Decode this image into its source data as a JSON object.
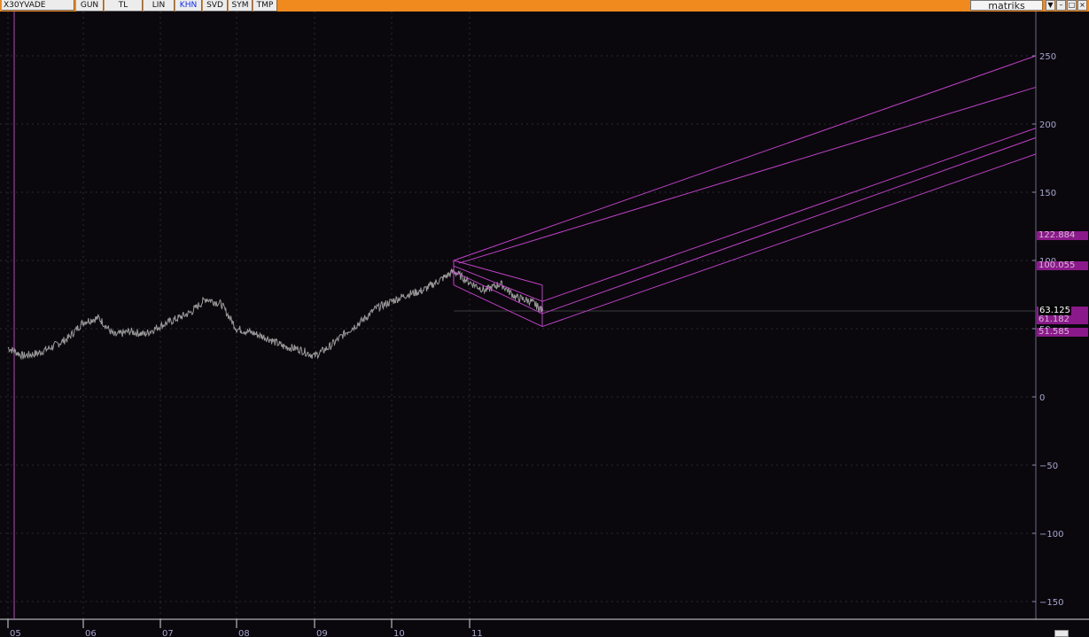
{
  "toolbar": {
    "symbol": "X30YVADE",
    "buttons": [
      "GUN",
      "TL",
      "LIN",
      "KHN",
      "SVD",
      "SYM",
      "TMP"
    ],
    "active_button": "KHN",
    "brand": "matriks",
    "window_controls": [
      "▼",
      "–",
      "□",
      "×"
    ]
  },
  "colors": {
    "toolbar_bg": "#f08a1f",
    "chart_bg": "#0a080c",
    "price_line": "#9a9a9a",
    "channel_lines": "#c040c8",
    "axis_text": "#a8a6d0",
    "tag_bg": "#8a1a8a"
  },
  "price_tags": {
    "upper": "122.884",
    "middle": "100.055",
    "last": "63.125",
    "hidden": "61.182",
    "lower": "51.585"
  },
  "chart_data": {
    "type": "line",
    "y_axis": {
      "ticks": [
        250,
        200,
        150,
        100,
        50,
        0,
        -50,
        -100,
        -150
      ],
      "tick_labels": [
        "250",
        "200",
        "150",
        "100",
        "50",
        "0",
        "−50",
        "−100",
        "−150"
      ],
      "range": [
        -158,
        280
      ],
      "position": "right",
      "grid": true
    },
    "x_axis": {
      "tick_labels": [
        "05",
        "06",
        "07",
        "08",
        "09",
        "10",
        "11"
      ],
      "grid": true
    },
    "series": [
      {
        "x": [
          2005.0,
          2005.2,
          2005.4,
          2005.6,
          2005.8,
          2006.0,
          2006.2,
          2006.4,
          2006.6,
          2006.8,
          2007.0,
          2007.2,
          2007.4,
          2007.6,
          2007.8,
          2008.0,
          2008.2,
          2008.4,
          2008.6,
          2008.8,
          2009.0,
          2009.2,
          2009.4,
          2009.6,
          2009.8,
          2010.0,
          2010.2,
          2010.4,
          2010.6,
          2010.8,
          2011.0,
          2011.2,
          2011.4,
          2011.6,
          2011.8,
          2011.95
        ],
        "y": [
          36,
          30,
          32,
          37,
          43,
          55,
          58,
          45,
          48,
          46,
          52,
          57,
          62,
          72,
          68,
          50,
          47,
          43,
          37,
          35,
          30,
          37,
          47,
          55,
          65,
          70,
          75,
          78,
          85,
          92,
          84,
          78,
          83,
          73,
          70,
          63
        ]
      }
    ],
    "projection_channel": {
      "box_high": 100,
      "box_low": 51.585,
      "upper_projection_end": 250,
      "lower_projection_end": 178
    },
    "last_value": 63.125
  }
}
